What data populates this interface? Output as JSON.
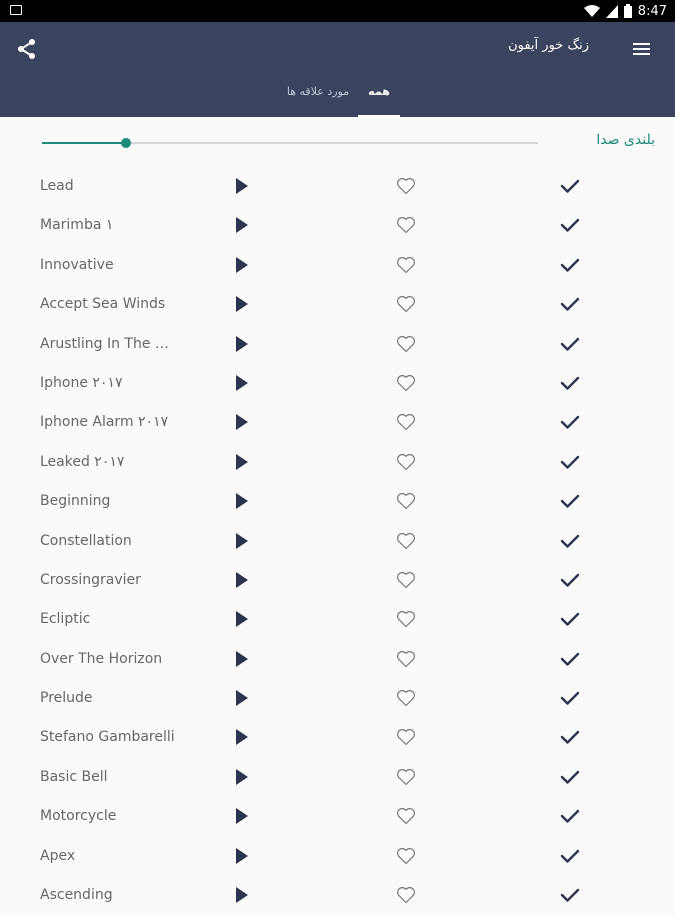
{
  "status_bar": {
    "time": "8:47"
  },
  "toolbar": {
    "title": "زنگ خور آیفون"
  },
  "tabs": {
    "all": "همه",
    "favorites": "مورد علاقه ها"
  },
  "volume": {
    "label": "بلندی صدا",
    "level_fraction": 0.17
  },
  "colors": {
    "toolbar": "#3a445f",
    "accent": "#1e8a7a"
  },
  "ringtones": [
    {
      "name": "Lead"
    },
    {
      "name": "Marimba ۱"
    },
    {
      "name": "Innovative"
    },
    {
      "name": "Accept Sea Winds"
    },
    {
      "name": "Arustling In The Tr..."
    },
    {
      "name": "Iphone ۲۰۱۷"
    },
    {
      "name": "Iphone Alarm ۲۰۱۷"
    },
    {
      "name": "Leaked ۲۰۱۷"
    },
    {
      "name": "Beginning"
    },
    {
      "name": "Constellation"
    },
    {
      "name": "Crossingravier"
    },
    {
      "name": "Ecliptic"
    },
    {
      "name": "Over The Horizon"
    },
    {
      "name": "Prelude"
    },
    {
      "name": "Stefano Gambarelli"
    },
    {
      "name": "Basic Bell"
    },
    {
      "name": "Motorcycle"
    },
    {
      "name": "Apex"
    },
    {
      "name": "Ascending"
    }
  ]
}
